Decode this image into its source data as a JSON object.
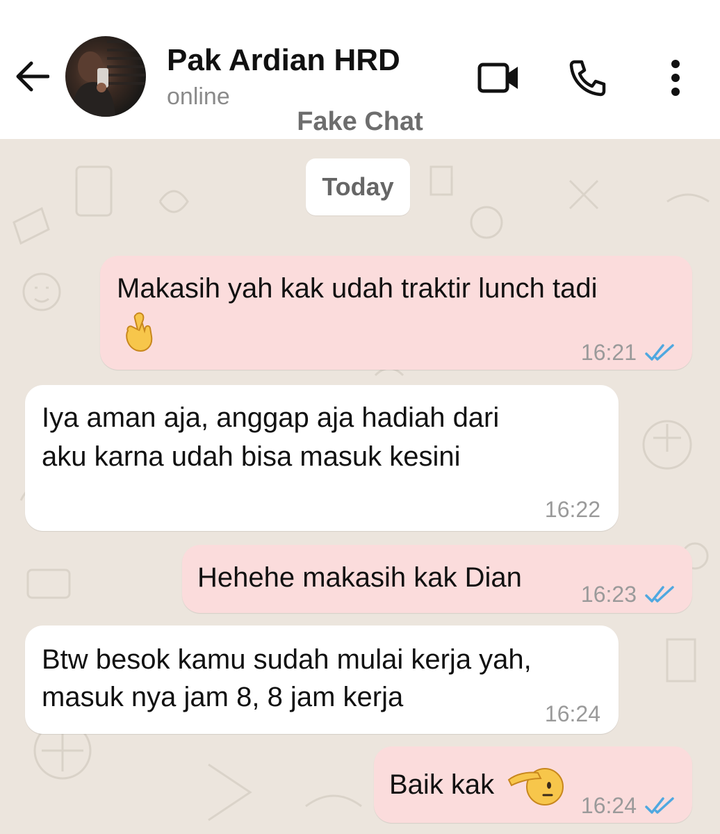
{
  "header": {
    "contact_name": "Pak Ardian HRD",
    "status": "online",
    "watermark": "Fake Chat",
    "icons": [
      "back-arrow-icon",
      "avatar",
      "video-camera-icon",
      "phone-icon",
      "more-vert-icon"
    ]
  },
  "chat": {
    "date_label": "Today",
    "messages": [
      {
        "direction": "outgoing",
        "lines": [
          "Makasih yah kak udah traktir lunch tadi"
        ],
        "emoji": "crossed-fingers-emoji",
        "time": "16:21",
        "status": "read"
      },
      {
        "direction": "incoming",
        "lines": [
          "Iya aman aja, anggap aja hadiah dari",
          "aku karna udah bisa masuk kesini"
        ],
        "time": "16:22"
      },
      {
        "direction": "outgoing",
        "lines": [
          "Hehehe makasih kak Dian"
        ],
        "time": "16:23",
        "status": "read"
      },
      {
        "direction": "incoming",
        "lines": [
          "Btw besok kamu sudah mulai kerja yah,",
          "masuk nya jam 8, 8 jam kerja"
        ],
        "time": "16:24"
      },
      {
        "direction": "outgoing",
        "lines": [
          "Baik kak"
        ],
        "emoji": "saluting-face-emoji",
        "time": "16:24",
        "status": "read"
      }
    ]
  },
  "colors": {
    "chat_background": "#ece5dd",
    "outgoing_bubble": "#fbdcdc",
    "incoming_bubble": "#ffffff",
    "read_ticks": "#4fa8e0"
  }
}
